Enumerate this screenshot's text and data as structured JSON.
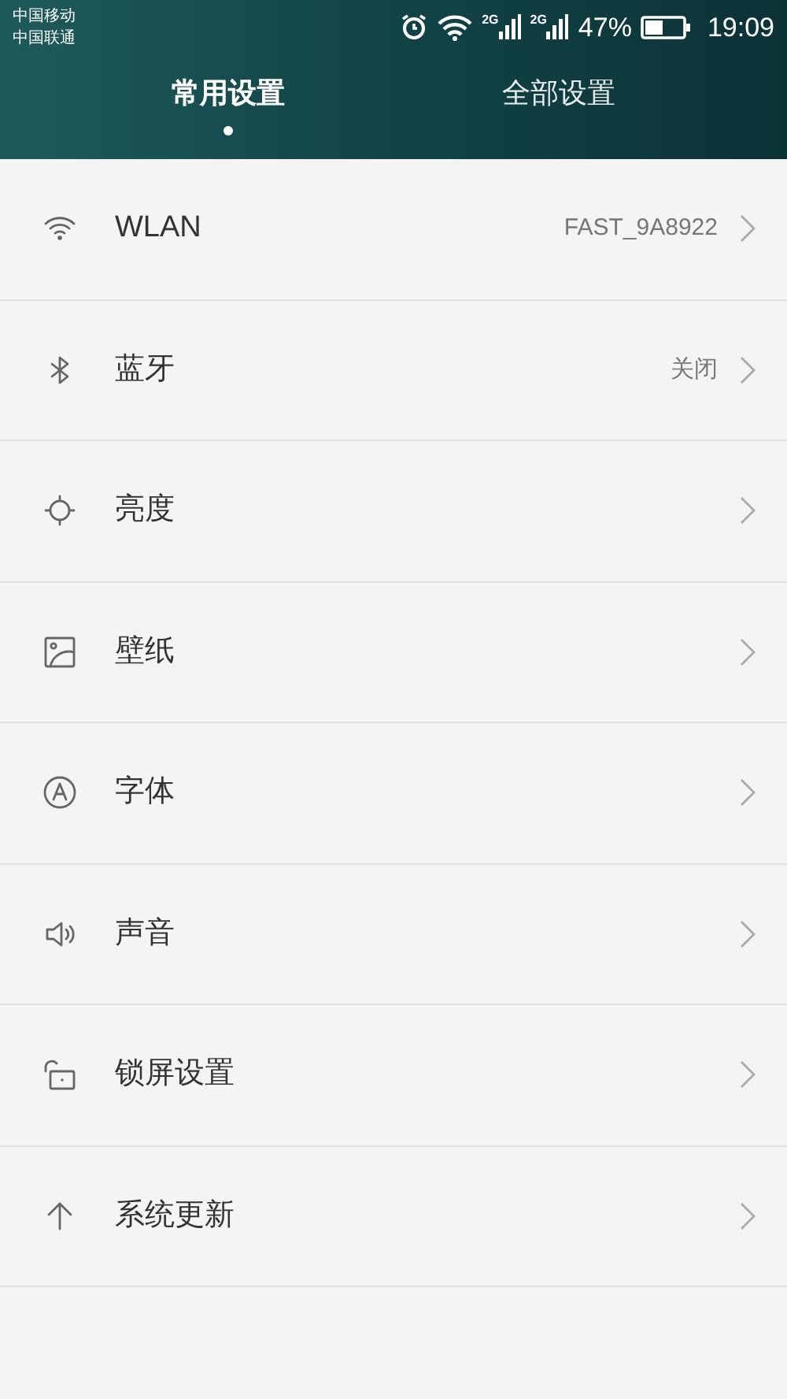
{
  "status_bar": {
    "carriers": [
      "中国移动",
      "中国联通"
    ],
    "signals": [
      {
        "network": "2G"
      },
      {
        "network": "2G"
      }
    ],
    "battery": "47%",
    "time": "19:09"
  },
  "tabs": [
    {
      "label": "常用设置",
      "selected": true
    },
    {
      "label": "全部设置",
      "selected": false
    }
  ],
  "settings": [
    {
      "kind": "wifi",
      "label": "WLAN",
      "value": "FAST_9A8922"
    },
    {
      "kind": "bluetooth",
      "label": "蓝牙",
      "value": "关闭"
    },
    {
      "kind": "brightness",
      "label": "亮度"
    },
    {
      "kind": "wallpaper",
      "label": "壁纸"
    },
    {
      "kind": "font",
      "label": "字体"
    },
    {
      "kind": "sound",
      "label": "声音"
    },
    {
      "kind": "lock",
      "label": "锁屏设置"
    },
    {
      "kind": "update",
      "label": "系统更新"
    }
  ]
}
